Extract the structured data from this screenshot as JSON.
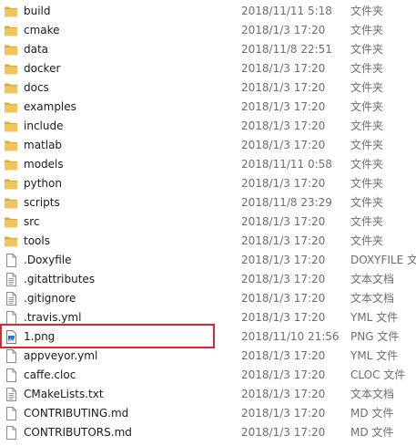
{
  "colors": {
    "folder": "#f2c55c",
    "folder_dark": "#dcaa3a",
    "highlight": "#e0262d"
  },
  "files": [
    {
      "name": "build",
      "date": "2018/11/11 5:18",
      "type": "文件夹",
      "icon": "folder-icon"
    },
    {
      "name": "cmake",
      "date": "2018/1/3 17:20",
      "type": "文件夹",
      "icon": "folder-icon"
    },
    {
      "name": "data",
      "date": "2018/11/8 22:51",
      "type": "文件夹",
      "icon": "folder-icon"
    },
    {
      "name": "docker",
      "date": "2018/1/3 17:20",
      "type": "文件夹",
      "icon": "folder-icon"
    },
    {
      "name": "docs",
      "date": "2018/1/3 17:20",
      "type": "文件夹",
      "icon": "folder-icon"
    },
    {
      "name": "examples",
      "date": "2018/1/3 17:20",
      "type": "文件夹",
      "icon": "folder-icon"
    },
    {
      "name": "include",
      "date": "2018/1/3 17:20",
      "type": "文件夹",
      "icon": "folder-icon"
    },
    {
      "name": "matlab",
      "date": "2018/1/3 17:20",
      "type": "文件夹",
      "icon": "folder-icon"
    },
    {
      "name": "models",
      "date": "2018/11/11 0:58",
      "type": "文件夹",
      "icon": "folder-icon"
    },
    {
      "name": "python",
      "date": "2018/1/3 17:20",
      "type": "文件夹",
      "icon": "folder-icon"
    },
    {
      "name": "scripts",
      "date": "2018/11/8 23:29",
      "type": "文件夹",
      "icon": "folder-icon"
    },
    {
      "name": "src",
      "date": "2018/1/3 17:20",
      "type": "文件夹",
      "icon": "folder-icon"
    },
    {
      "name": "tools",
      "date": "2018/1/3 17:20",
      "type": "文件夹",
      "icon": "folder-icon"
    },
    {
      "name": ".Doxyfile",
      "date": "2018/1/3 17:20",
      "type": "DOXYFILE 文件",
      "icon": "file-icon"
    },
    {
      "name": ".gitattributes",
      "date": "2018/1/3 17:20",
      "type": "文本文档",
      "icon": "text-file-icon"
    },
    {
      "name": ".gitignore",
      "date": "2018/1/3 17:20",
      "type": "文本文档",
      "icon": "text-file-icon"
    },
    {
      "name": ".travis.yml",
      "date": "2018/1/3 17:20",
      "type": "YML 文件",
      "icon": "file-icon"
    },
    {
      "name": "1.png",
      "date": "2018/11/10 21:56",
      "type": "PNG 文件",
      "icon": "image-file-icon"
    },
    {
      "name": "appveyor.yml",
      "date": "2018/1/3 17:20",
      "type": "YML 文件",
      "icon": "file-icon"
    },
    {
      "name": "caffe.cloc",
      "date": "2018/1/3 17:20",
      "type": "CLOC 文件",
      "icon": "file-icon"
    },
    {
      "name": "CMakeLists.txt",
      "date": "2018/1/3 17:20",
      "type": "文本文档",
      "icon": "text-file-icon"
    },
    {
      "name": "CONTRIBUTING.md",
      "date": "2018/1/3 17:20",
      "type": "MD 文件",
      "icon": "file-icon"
    },
    {
      "name": "CONTRIBUTORS.md",
      "date": "2018/1/3 17:20",
      "type": "MD 文件",
      "icon": "file-icon"
    }
  ]
}
